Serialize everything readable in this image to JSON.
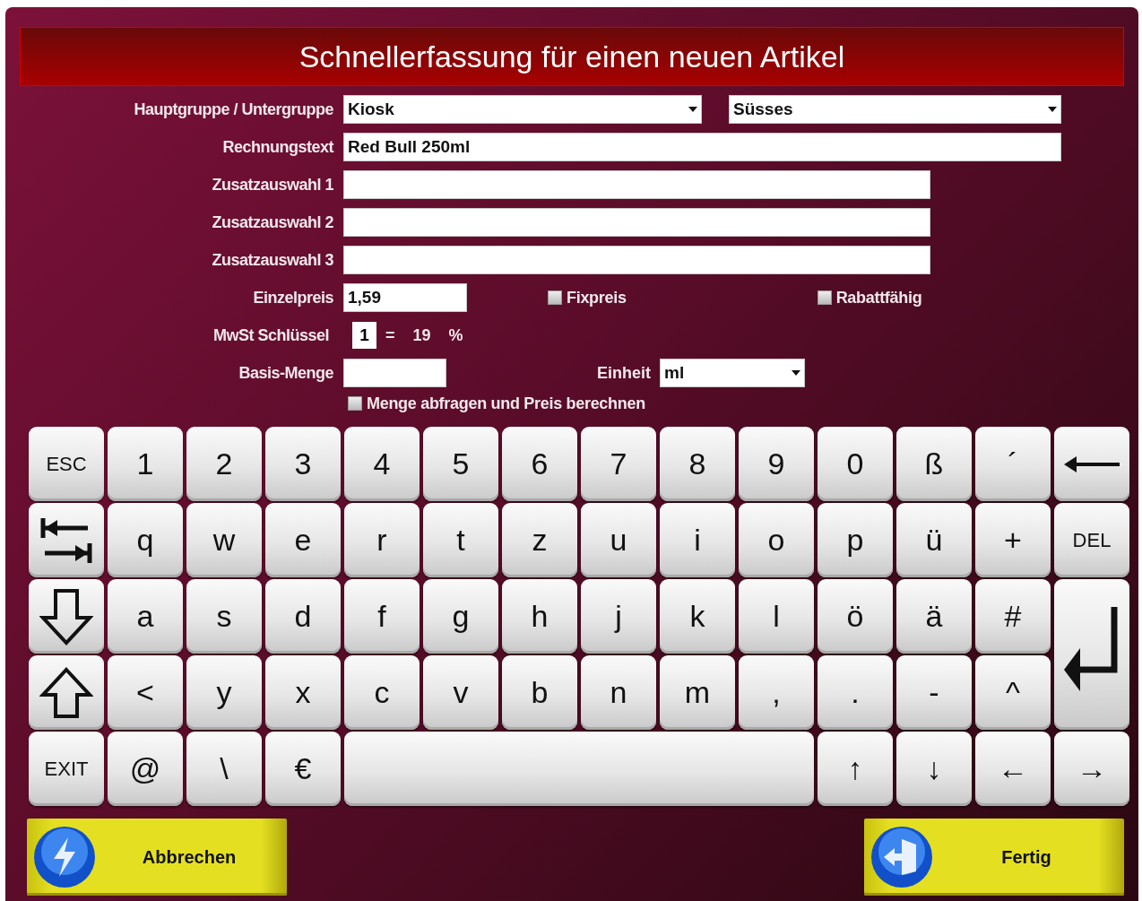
{
  "title": "Schnellerfassung für einen neuen Artikel",
  "group_row": {
    "label": "Hauptgruppe / Untergruppe",
    "main_group": "Kiosk",
    "sub_group": "Süsses"
  },
  "invoice_text": {
    "label": "Rechnungstext",
    "value": "Red Bull 250ml"
  },
  "extra_selections": [
    {
      "label": "Zusatzauswahl 1"
    },
    {
      "label": "Zusatzauswahl 2"
    },
    {
      "label": "Zusatzauswahl 3"
    }
  ],
  "unit_price": {
    "label": "Einzelpreis",
    "value": "1,59"
  },
  "options": [
    {
      "label": "Fixpreis",
      "checked": false
    },
    {
      "label": "Rabattfähig",
      "checked": false
    }
  ],
  "vat": {
    "label": "MwSt Schlüssel",
    "key": "1",
    "equals": "=",
    "rate": "19",
    "unit": "%"
  },
  "base_quantity": {
    "label": "Basis-Menge"
  },
  "unit": {
    "label": "Einheit",
    "value": "ml"
  },
  "ask_quantity": {
    "label": "Menge abfragen und Preis berechnen",
    "checked": false
  },
  "keyboard": {
    "keys": [
      {
        "kind": "word",
        "label": "ESC"
      },
      {
        "kind": "char",
        "label": "1"
      },
      {
        "kind": "char",
        "label": "2"
      },
      {
        "kind": "char",
        "label": "3"
      },
      {
        "kind": "char",
        "label": "4"
      },
      {
        "kind": "char",
        "label": "5"
      },
      {
        "kind": "char",
        "label": "6"
      },
      {
        "kind": "char",
        "label": "7"
      },
      {
        "kind": "char",
        "label": "8"
      },
      {
        "kind": "char",
        "label": "9"
      },
      {
        "kind": "char",
        "label": "0"
      },
      {
        "kind": "char",
        "label": "ß"
      },
      {
        "kind": "char",
        "label": "´"
      },
      {
        "kind": "backspace"
      },
      {
        "kind": "tab"
      },
      {
        "kind": "char",
        "label": "q"
      },
      {
        "kind": "char",
        "label": "w"
      },
      {
        "kind": "char",
        "label": "e"
      },
      {
        "kind": "char",
        "label": "r"
      },
      {
        "kind": "char",
        "label": "t"
      },
      {
        "kind": "char",
        "label": "z"
      },
      {
        "kind": "char",
        "label": "u"
      },
      {
        "kind": "char",
        "label": "i"
      },
      {
        "kind": "char",
        "label": "o"
      },
      {
        "kind": "char",
        "label": "p"
      },
      {
        "kind": "char",
        "label": "ü"
      },
      {
        "kind": "char",
        "label": "+"
      },
      {
        "kind": "word",
        "label": "DEL"
      },
      {
        "kind": "capslock"
      },
      {
        "kind": "char",
        "label": "a"
      },
      {
        "kind": "char",
        "label": "s"
      },
      {
        "kind": "char",
        "label": "d"
      },
      {
        "kind": "char",
        "label": "f"
      },
      {
        "kind": "char",
        "label": "g"
      },
      {
        "kind": "char",
        "label": "h"
      },
      {
        "kind": "char",
        "label": "j"
      },
      {
        "kind": "char",
        "label": "k"
      },
      {
        "kind": "char",
        "label": "l"
      },
      {
        "kind": "char",
        "label": "ö"
      },
      {
        "kind": "char",
        "label": "ä"
      },
      {
        "kind": "char",
        "label": "#"
      },
      {
        "kind": "enter"
      },
      {
        "kind": "shift"
      },
      {
        "kind": "char",
        "label": "<"
      },
      {
        "kind": "char",
        "label": "y"
      },
      {
        "kind": "char",
        "label": "x"
      },
      {
        "kind": "char",
        "label": "c"
      },
      {
        "kind": "char",
        "label": "v"
      },
      {
        "kind": "char",
        "label": "b"
      },
      {
        "kind": "char",
        "label": "n"
      },
      {
        "kind": "char",
        "label": "m"
      },
      {
        "kind": "char",
        "label": ","
      },
      {
        "kind": "char",
        "label": "."
      },
      {
        "kind": "char",
        "label": "-"
      },
      {
        "kind": "char",
        "label": "^"
      },
      {
        "kind": "word",
        "label": "EXIT"
      },
      {
        "kind": "char",
        "label": "@"
      },
      {
        "kind": "char",
        "label": "\\"
      },
      {
        "kind": "char",
        "label": "€"
      },
      {
        "kind": "space"
      },
      {
        "kind": "char",
        "label": "↑"
      },
      {
        "kind": "char",
        "label": "↓"
      },
      {
        "kind": "char",
        "label": "←"
      },
      {
        "kind": "char",
        "label": "→"
      }
    ]
  },
  "buttons": [
    {
      "kind": "cancel",
      "label": "Abbrechen"
    },
    {
      "kind": "done",
      "label": "Fertig"
    }
  ]
}
